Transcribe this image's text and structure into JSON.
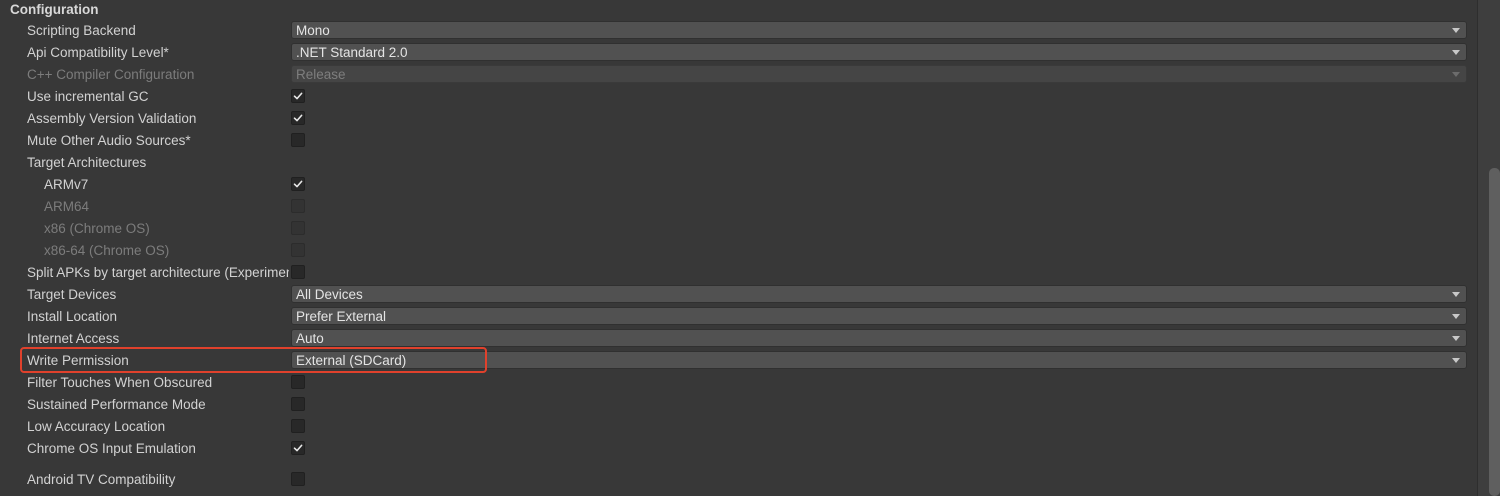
{
  "section": {
    "title": "Configuration"
  },
  "rows": {
    "scripting_backend": {
      "label": "Scripting Backend",
      "value": "Mono"
    },
    "api_level": {
      "label": "Api Compatibility Level*",
      "value": ".NET Standard 2.0"
    },
    "cpp_config": {
      "label": "C++ Compiler Configuration",
      "value": "Release"
    },
    "incremental_gc": {
      "label": "Use incremental GC",
      "checked": true
    },
    "assembly_validation": {
      "label": "Assembly Version Validation",
      "checked": true
    },
    "mute_audio": {
      "label": "Mute Other Audio Sources*",
      "checked": false
    },
    "target_arch": {
      "label": "Target Architectures"
    },
    "armv7": {
      "label": "ARMv7",
      "checked": true
    },
    "arm64": {
      "label": "ARM64",
      "checked": false
    },
    "x86": {
      "label": "x86 (Chrome OS)",
      "checked": false
    },
    "x86_64": {
      "label": "x86-64 (Chrome OS)",
      "checked": false
    },
    "split_apks": {
      "label": "Split APKs by target architecture (Experimental)",
      "checked": false
    },
    "target_devices": {
      "label": "Target Devices",
      "value": "All Devices"
    },
    "install_location": {
      "label": "Install Location",
      "value": "Prefer External"
    },
    "internet_access": {
      "label": "Internet Access",
      "value": "Auto"
    },
    "write_permission": {
      "label": "Write Permission",
      "value": "External (SDCard)"
    },
    "filter_touches": {
      "label": "Filter Touches When Obscured",
      "checked": false
    },
    "sustained_perf": {
      "label": "Sustained Performance Mode",
      "checked": false
    },
    "low_accuracy": {
      "label": "Low Accuracy Location",
      "checked": false
    },
    "chrome_input": {
      "label": "Chrome OS Input Emulation",
      "checked": true
    },
    "android_tv": {
      "label": "Android TV Compatibility",
      "checked": false
    }
  },
  "colors": {
    "panel_bg": "#383838",
    "highlight": "#e0412c",
    "field_bg": "#515151"
  },
  "icons": {
    "checkmark": "check-icon",
    "dropdown": "chevron-down-icon"
  }
}
